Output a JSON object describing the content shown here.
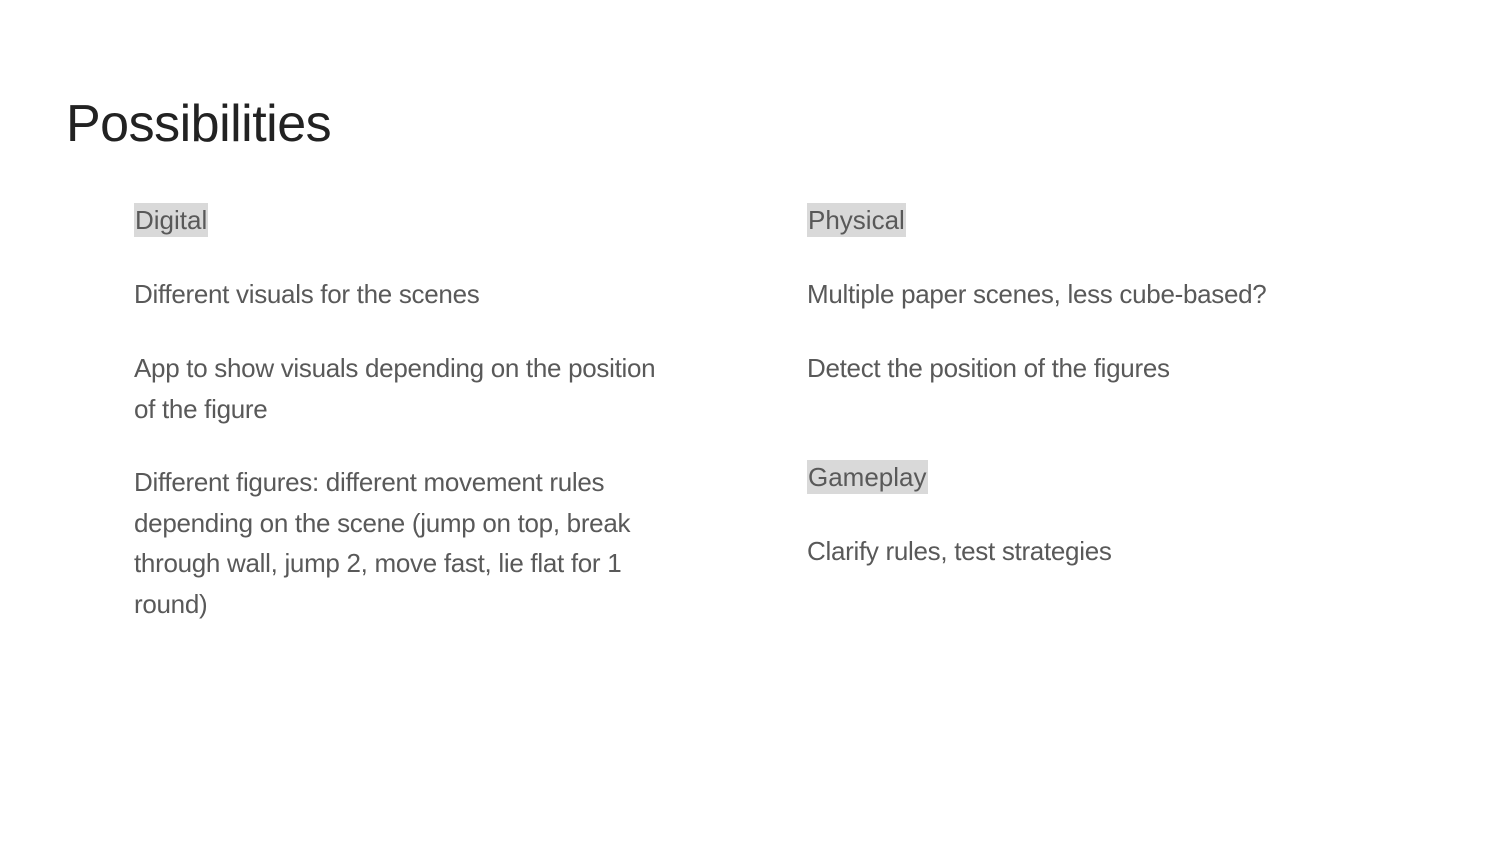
{
  "slide": {
    "title": "Possibilities",
    "columns": {
      "left": {
        "heading": "Digital",
        "items": [
          "Different visuals for the scenes",
          "App to show visuals depending on the position of the figure",
          "Different figures: different movement rules depending on the scene (jump on top, break through wall, jump 2, move fast, lie flat for 1 round)"
        ]
      },
      "right": {
        "sections": [
          {
            "heading": "Physical",
            "items": [
              "Multiple paper scenes, less cube-based?",
              "Detect the position of the figures"
            ]
          },
          {
            "heading": "Gameplay",
            "items": [
              "Clarify rules, test strategies"
            ]
          }
        ]
      }
    }
  },
  "colors": {
    "title": "#222222",
    "body_text": "#595959",
    "heading_highlight": "#d9d9d9",
    "background": "#ffffff"
  }
}
